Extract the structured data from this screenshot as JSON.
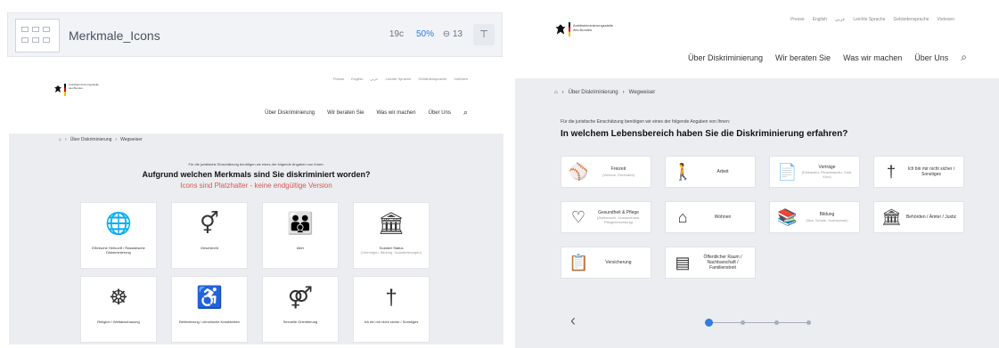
{
  "left": {
    "tool": {
      "title": "Merkmale_Icons",
      "stat1": "19c",
      "zoom": "50%",
      "comments": "13"
    },
    "header": {
      "org_line1": "Antidiskriminierungsstelle",
      "org_line2": "des Bundes",
      "utility": [
        "Presse",
        "English",
        "عربي",
        "Leichte Sprache",
        "Gebärdensprache",
        "Vorlesen"
      ],
      "nav": [
        "Über Diskriminierung",
        "Wir beraten Sie",
        "Was wir machen",
        "Über Uns"
      ]
    },
    "breadcrumb": [
      "Über Diskriminierung",
      "Wegweiser"
    ],
    "intro": "Für die juristische Einschätzung benötigen wir eines der folgende Angaben von Ihnen:",
    "question": "Aufgrund welchen Merkmals sind Sie diskriminiert worden?",
    "warning": "Icons sind Platzhalter - keine endgültige Version",
    "cards": [
      {
        "icon": "globe-people-icon",
        "glyph": "🌐",
        "label": "Ethnische Herkunft / Rassistische Diskriminierung",
        "sub": ""
      },
      {
        "icon": "gender-icon",
        "glyph": "⚥",
        "label": "Geschlecht",
        "sub": ""
      },
      {
        "icon": "age-icon",
        "glyph": "👪",
        "label": "Alter",
        "sub": ""
      },
      {
        "icon": "social-status-icon",
        "glyph": "🏛",
        "label": "Sozialer Status",
        "sub": "(Vermögen, Bildung, Sozialleistungen)"
      },
      {
        "icon": "religion-icon",
        "glyph": "☸",
        "label": "Religion / Weltanschauung",
        "sub": ""
      },
      {
        "icon": "disability-icon",
        "glyph": "♿",
        "label": "Behinderung / chronische Krankheiten",
        "sub": ""
      },
      {
        "icon": "sexual-orientation-icon",
        "glyph": "⚤",
        "label": "Sexuelle Orientierung",
        "sub": ""
      },
      {
        "icon": "unsure-icon",
        "glyph": "†",
        "label": "Ich bin mir nicht sicher / Sonstiges",
        "sub": ""
      }
    ]
  },
  "right": {
    "header": {
      "org_line1": "Antidiskriminierungsstelle",
      "org_line2": "des Bundes",
      "utility": [
        "Presse",
        "English",
        "عربي",
        "Leichte Sprache",
        "Gebärdensprache",
        "Vorlesen"
      ],
      "nav": [
        "Über Diskriminierung",
        "Wir beraten Sie",
        "Was wir machen",
        "Über Uns"
      ]
    },
    "breadcrumb": [
      "Über Diskriminierung",
      "Wegweiser"
    ],
    "intro": "Für die juristische Einschätzung benötigen wir eines der folgende Angaben von Ihnen:",
    "question": "In welchem Lebensbereich haben Sie die Diskriminierung erfahren?",
    "cards": [
      {
        "icon": "leisure-icon",
        "glyph": "⚾",
        "label": "Freizeit",
        "sub": "(Vereine, Ehrenamt)"
      },
      {
        "icon": "work-icon",
        "glyph": "🚶",
        "label": "Arbeit",
        "sub": ""
      },
      {
        "icon": "contracts-icon",
        "glyph": "📄",
        "label": "Verträge",
        "sub": "(Einkaufen, Fitnessstudio, Club, Kino)"
      },
      {
        "icon": "unsure-icon",
        "glyph": "†",
        "label": "Ich bin mir nicht sicher / Sonstiges",
        "sub": ""
      },
      {
        "icon": "health-icon",
        "glyph": "♡",
        "label": "Gesundheit & Pflege",
        "sub": "(Arztbesuch, Krankenhaus, Pflegeeinrichtung)"
      },
      {
        "icon": "housing-icon",
        "glyph": "⌂",
        "label": "Wohnen",
        "sub": ""
      },
      {
        "icon": "education-icon",
        "glyph": "📚",
        "label": "Bildung",
        "sub": "(Kita, Schule, Hochschule)"
      },
      {
        "icon": "authorities-icon",
        "glyph": "🏛",
        "label": "Behörden / Ämter / Justiz",
        "sub": ""
      },
      {
        "icon": "insurance-icon",
        "glyph": "📋",
        "label": "Versicherung",
        "sub": ""
      },
      {
        "icon": "public-space-icon",
        "glyph": "▤",
        "label": "Öffentlicher Raum / Nachbarschaft / Familienstreit",
        "sub": ""
      }
    ],
    "pagination": {
      "current": 1,
      "total": 4
    }
  },
  "colors": {
    "accent": "#2f7de1",
    "warning": "#e05555",
    "flag": [
      "#111111",
      "#dd0000",
      "#f2c200"
    ]
  }
}
